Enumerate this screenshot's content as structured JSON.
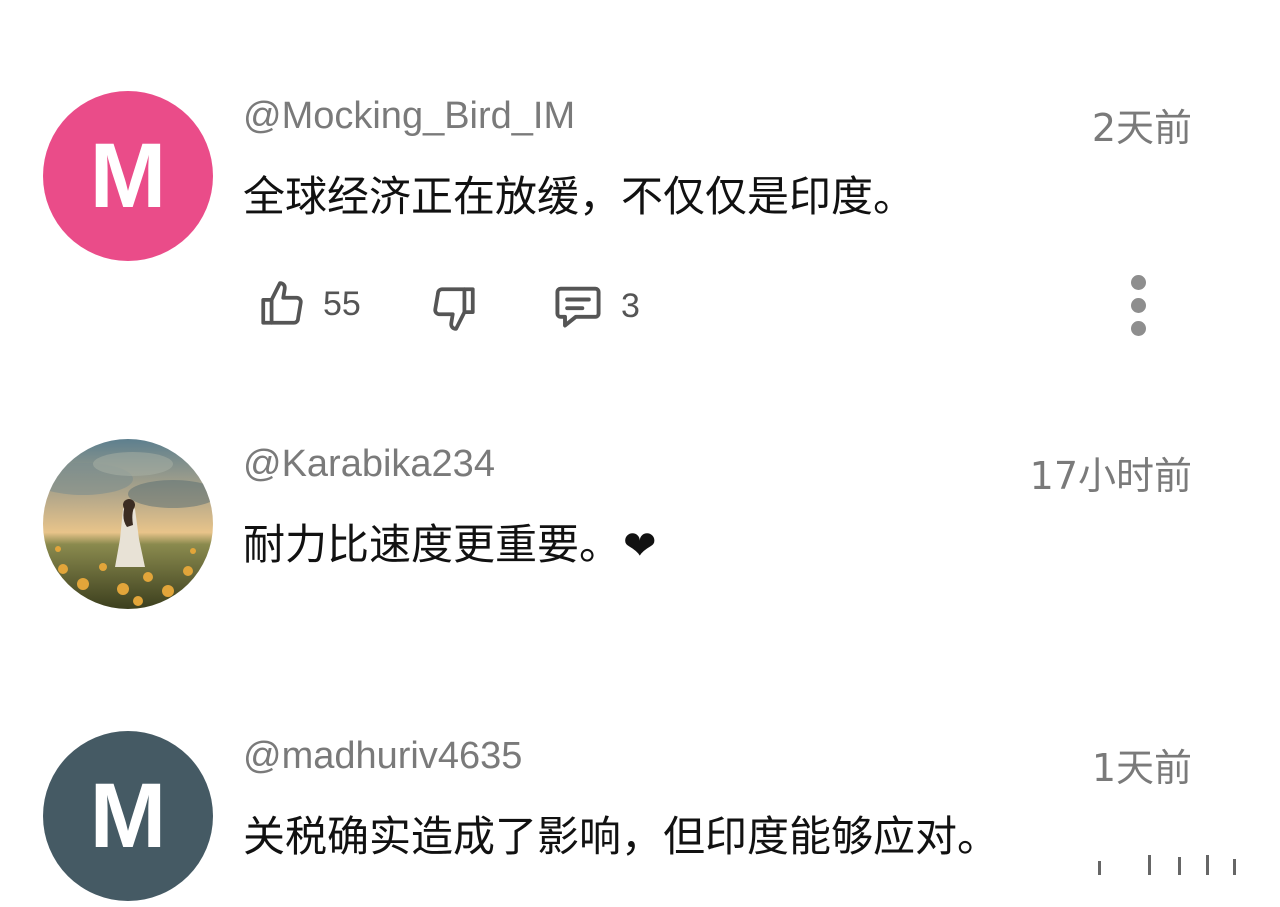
{
  "colors": {
    "avatar1": "#ea4c89",
    "avatar3": "#455a64",
    "muted_text": "#7a7a7a",
    "body_text": "#111111",
    "icon": "#555555"
  },
  "comments": [
    {
      "avatar_letter": "M",
      "username": "@Mocking_Bird_IM",
      "time": "2天前",
      "text": "全球经济正在放缓，不仅仅是印度。",
      "likes": "55",
      "replies": "3",
      "icons": [
        "thumbs-up-icon",
        "thumbs-down-icon",
        "comment-icon",
        "more-vertical-icon"
      ]
    },
    {
      "avatar_image": "girl-in-flower-field",
      "username": "@Karabika234",
      "time": "17小时前",
      "text": "耐力比速度更重要。",
      "emoji": "❤"
    },
    {
      "avatar_letter": "M",
      "username": "@madhuriv4635",
      "time": "1天前",
      "text": "关税确实造成了影响，但印度能够应对。"
    }
  ]
}
